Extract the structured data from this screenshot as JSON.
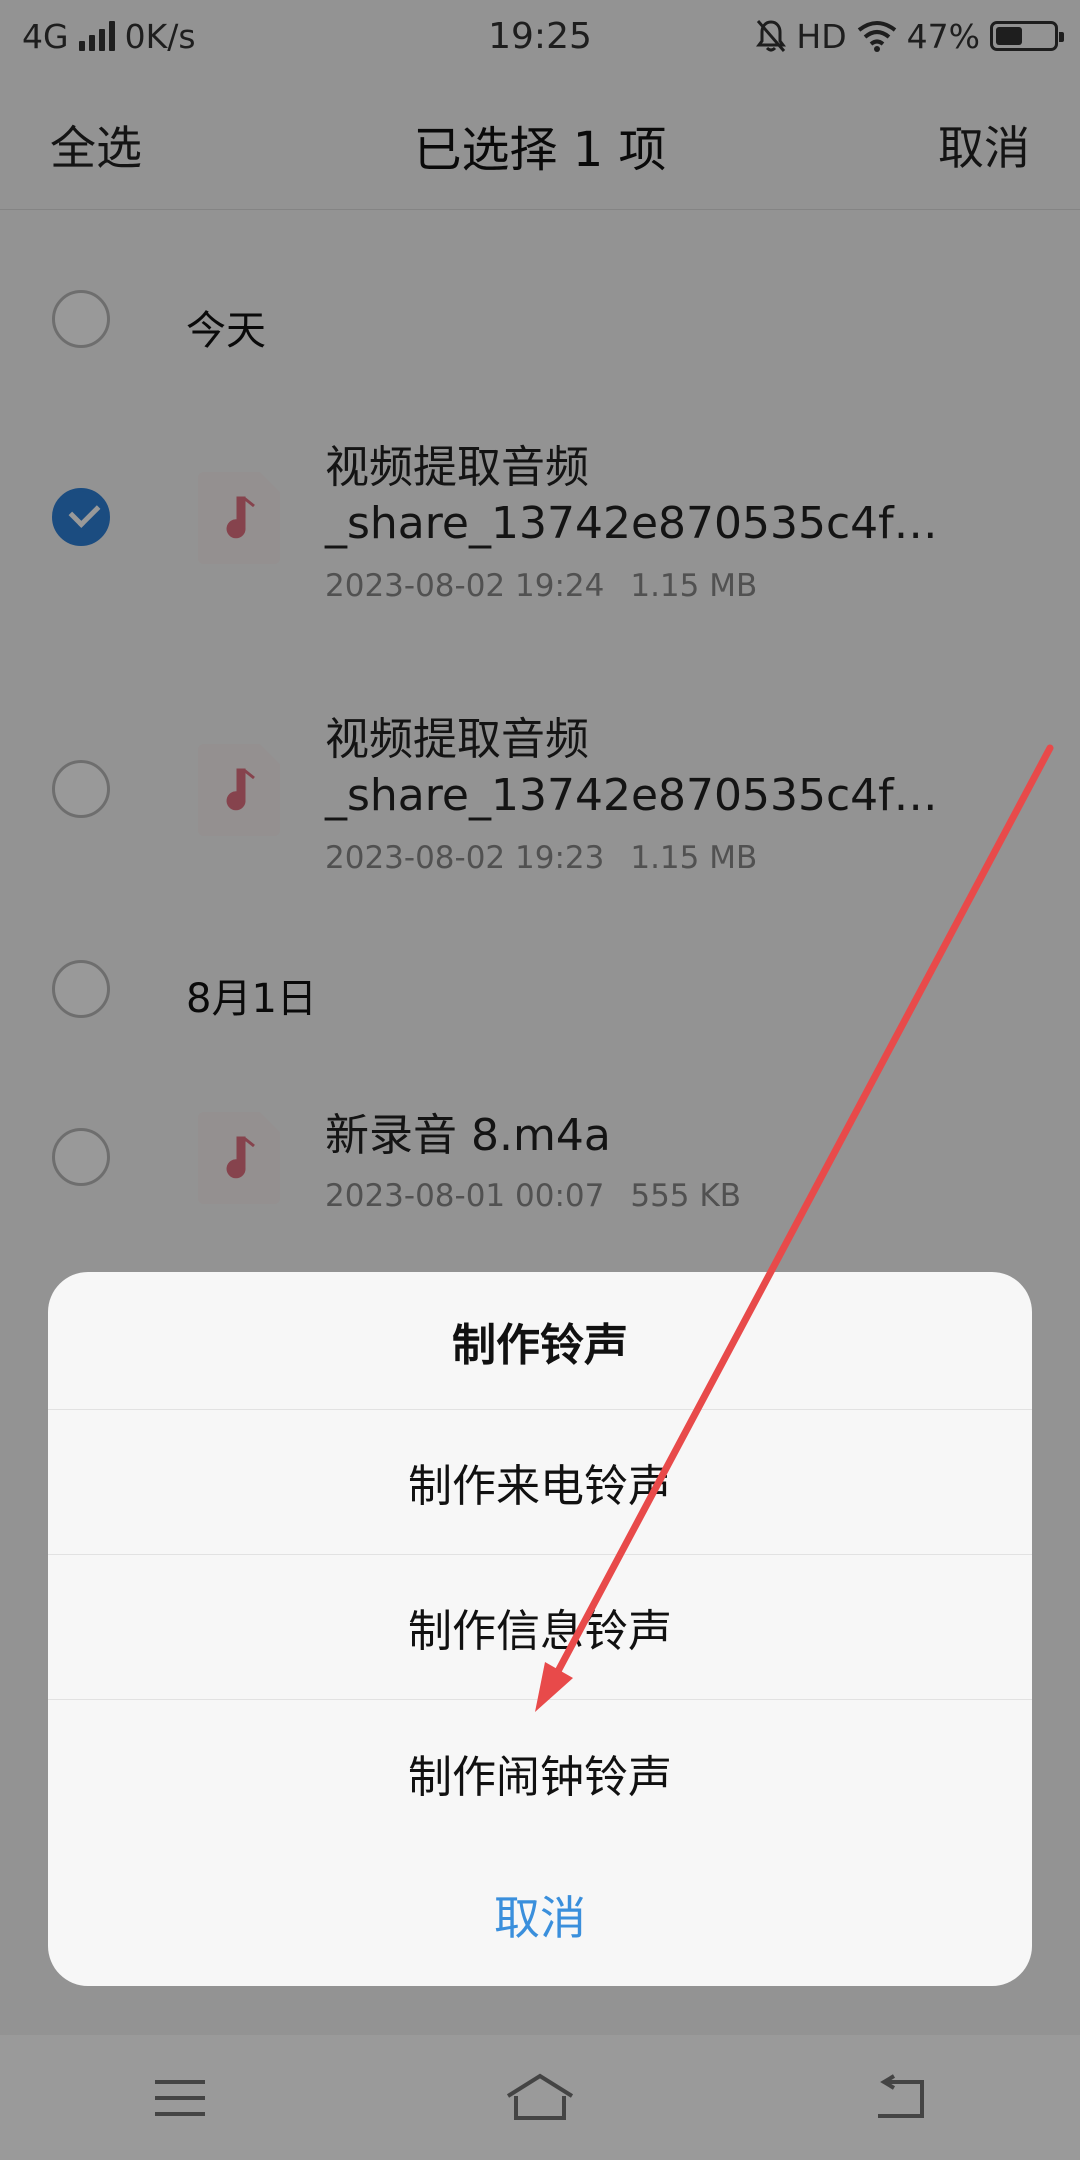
{
  "status_bar": {
    "network": "4G",
    "speed": "0K/s",
    "time": "19:25",
    "hd": "HD",
    "battery_percent": "47%",
    "battery_level": 0.47
  },
  "header": {
    "select_all": "全选",
    "title": "已选择 1 项",
    "cancel": "取消"
  },
  "list": {
    "groups": [
      {
        "label": "今天"
      },
      {
        "label": "8月1日"
      }
    ],
    "files": [
      {
        "title_line1": "视频提取音频",
        "title_line2": "_share_13742e870535c4f…",
        "date": "2023-08-02 19:24",
        "size": "1.15 MB",
        "selected": true
      },
      {
        "title_line1": "视频提取音频",
        "title_line2": "_share_13742e870535c4f…",
        "date": "2023-08-02 19:23",
        "size": "1.15 MB",
        "selected": false
      },
      {
        "title_line1": "新录音 8.m4a",
        "title_line2": "",
        "date": "2023-08-01 00:07",
        "size": "555 KB",
        "selected": false
      }
    ]
  },
  "sheet": {
    "title": "制作铃声",
    "items": [
      "制作来电铃声",
      "制作信息铃声",
      "制作闹钟铃声"
    ],
    "cancel": "取消"
  },
  "colors": {
    "accent": "#2d7fd6",
    "cancel_text": "#3a8fdc",
    "music_icon": "#e07080",
    "annotation_arrow": "#e84a4a"
  }
}
